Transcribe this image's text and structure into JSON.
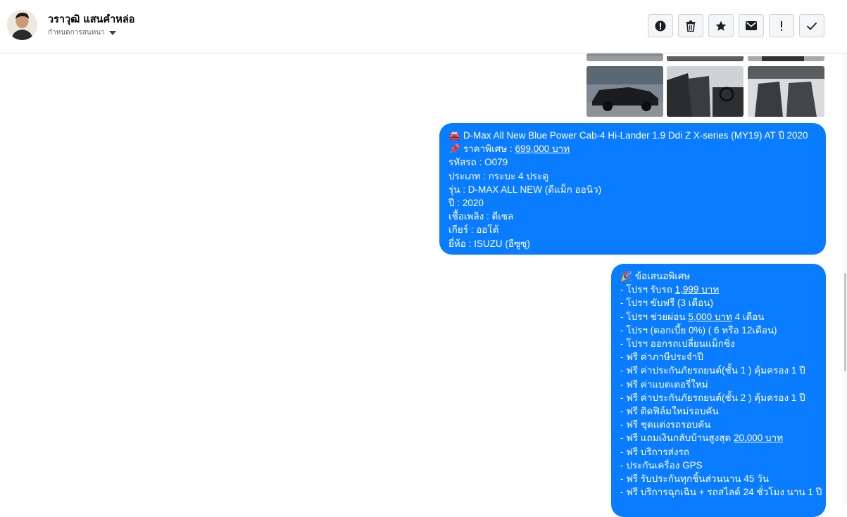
{
  "header": {
    "contact_name": "วราวุฒิ แสนคำหล่อ",
    "conversation_topic": "กำหนดการสนทนา"
  },
  "toolbar": {
    "buttons": [
      {
        "name": "report",
        "icon": "alert-circle-icon"
      },
      {
        "name": "delete",
        "icon": "trash-icon"
      },
      {
        "name": "star",
        "icon": "star-icon"
      },
      {
        "name": "mail",
        "icon": "envelope-icon"
      },
      {
        "name": "important",
        "icon": "exclamation-icon"
      },
      {
        "name": "done",
        "icon": "check-icon"
      }
    ]
  },
  "colors": {
    "bubble": "#0a7cff",
    "border": "#dadde1"
  },
  "message1": {
    "emoji1": "🚘",
    "title": "D-Max All New Blue Power Cab-4 Hi-Lander 1.9 Ddi Z X-series (MY19) AT ปี 2020",
    "emoji2": "📌",
    "price_label": "ราคาพิเศษ :",
    "price_value": "699,000 บาท",
    "code": "รหัสรถ : O079",
    "type": "ประเภท : กระบะ 4 ประตู",
    "model": "รุ่น : D-MAX ALL NEW (ดีแม็ก ออนิว)",
    "year": "ปี : 2020",
    "fuel": "เชื้อเพลิง : ดีเซล",
    "gear": "เกียร์ : ออโต้",
    "brand": "ยี่ห้อ : ISUZU (อีซูซุ)"
  },
  "message2": {
    "emoji": "🎉",
    "title": "ข้อเสนอพิเศษ",
    "l1a": "- โปรฯ รับรถ ",
    "l1u": "1,999 บาท",
    "l2": "- โปรฯ ขับฟรี (3 เดือน)",
    "l3a": "- โปรฯ ช่วยผ่อน ",
    "l3u": "5,000 บาท",
    "l3b": " 4 เดือน",
    "l4": "- โปรฯ (ดอกเบี้ย 0%) ( 6 หรือ 12เดือน)",
    "l5": "- โปรฯ ออกรถเปลี่ยนแม็กซิ่ง",
    "l6": "- ฟรี ค่าภาษีประจำปี",
    "l7": "- ฟรี ค่าประกันภัยรถยนต์(ชั้น 1 ) คุ้มครอง 1 ปี",
    "l8": "- ฟรี ค่าแบตเตอรี่ใหม่",
    "l9": "- ฟรี ค่าประกันภัยรถยนต์(ชั้น 2 ) คุ้มครอง 1 ปี",
    "l10": "- ฟรี ติดฟิล์มใหม่รอบคัน",
    "l11": "- ฟรี ชุดแต่งรถรอบคัน",
    "l12a": "- ฟรี แถมเงินกลับบ้านสูงสุด ",
    "l12u": "20,000 บาท",
    "l13": "- ฟรี บริการส่งรถ",
    "l14": "- ประกันเครื่อง GPS",
    "l15": "- ฟรี รับประกันทุกชิ้นส่วนนาน 45 วัน",
    "l16": "- ฟรี บริการฉุกเฉิน + รถสไลด์ 24 ชั่วโมง นาน 1 ปี"
  }
}
